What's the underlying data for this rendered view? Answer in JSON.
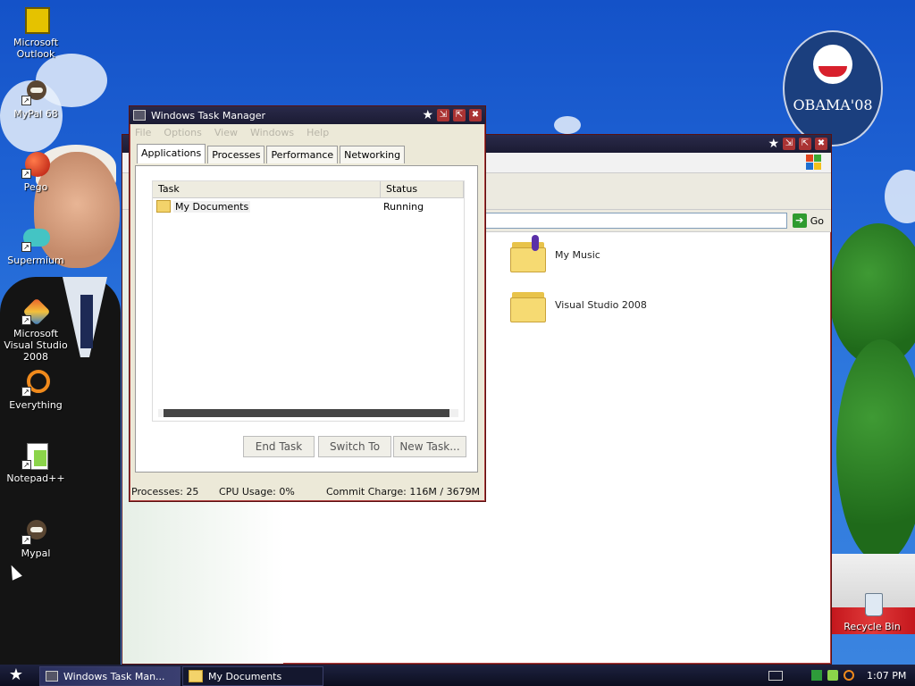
{
  "desktop": {
    "icons": [
      {
        "label": "Microsoft Outlook",
        "icon": "outlook-icon"
      },
      {
        "label": "MyPal 68",
        "icon": "mypal-icon"
      },
      {
        "label": "Pego",
        "icon": "pego-icon"
      },
      {
        "label": "Supermium",
        "icon": "supermium-icon"
      },
      {
        "label": "Microsoft Visual Studio 2008",
        "icon": "visual-studio-icon"
      },
      {
        "label": "Everything",
        "icon": "everything-icon"
      },
      {
        "label": "Notepad++",
        "icon": "notepad-plus-plus-icon"
      },
      {
        "label": "Mypal",
        "icon": "mypal-icon"
      }
    ],
    "recycle_bin": "Recycle Bin",
    "logo_text": "OBAMA'08"
  },
  "explorer": {
    "go_label": "Go",
    "folders": [
      {
        "label": "My Music",
        "icon": "music-folder-icon"
      },
      {
        "label": "Visual Studio 2008",
        "icon": "folder-icon"
      }
    ]
  },
  "task_manager": {
    "title": "Windows Task Manager",
    "menu": [
      "File",
      "Options",
      "View",
      "Windows",
      "Help"
    ],
    "tabs": [
      "Applications",
      "Processes",
      "Performance",
      "Networking"
    ],
    "active_tab": "Applications",
    "columns": [
      "Task",
      "Status"
    ],
    "rows": [
      {
        "task": "My Documents",
        "status": "Running"
      }
    ],
    "buttons": {
      "end_task": "End Task",
      "switch_to": "Switch To",
      "new_task": "New Task..."
    },
    "status": {
      "processes": "Processes: 25",
      "cpu": "CPU Usage: 0%",
      "commit": "Commit Charge: 116M / 3679M"
    }
  },
  "taskbar": {
    "tasks": [
      "Windows Task Man...",
      "My Documents"
    ],
    "clock": "1:07 PM"
  },
  "colors": {
    "title_bar": "#1b1b33",
    "window_border": "#8a1a1a",
    "desktop_sky": "#1f63d4"
  }
}
